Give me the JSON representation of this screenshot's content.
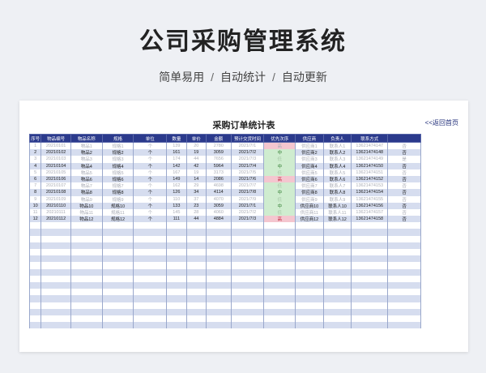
{
  "hero": {
    "title": "公司采购管理系统",
    "subtitle_parts": [
      "简单易用",
      "自动统计",
      "自动更新"
    ],
    "separator": "/"
  },
  "sheet": {
    "title": "采购订单统计表",
    "back_link": "<<返回首页"
  },
  "table": {
    "columns": [
      "序号",
      "物品编号",
      "物品名称",
      "规格",
      "单位",
      "数量",
      "单价",
      "金额",
      "预计交货时间",
      "优先次序",
      "供应商",
      "负责人",
      "联系方式",
      ""
    ],
    "rows": [
      {
        "no": "1",
        "code": "20210101",
        "name": "物品1",
        "spec": "规格1",
        "unit": "个",
        "qty": "139",
        "price": "20",
        "amount": "2780",
        "date": "2021/7/1",
        "priority": "高",
        "supplier": "供应商1",
        "owner": "联系人1",
        "phone": "13621474147",
        "extra": "否",
        "faded": true
      },
      {
        "no": "2",
        "code": "20210102",
        "name": "物品2",
        "spec": "规格2",
        "unit": "个",
        "qty": "161",
        "price": "19",
        "amount": "3059",
        "date": "2021/7/2",
        "priority": "中",
        "supplier": "供应商2",
        "owner": "联系人2",
        "phone": "13621474148",
        "extra": "否",
        "faded": false
      },
      {
        "no": "3",
        "code": "20210103",
        "name": "物品3",
        "spec": "规格3",
        "unit": "个",
        "qty": "174",
        "price": "44",
        "amount": "7656",
        "date": "2021/7/3",
        "priority": "低",
        "supplier": "供应商3",
        "owner": "联系人3",
        "phone": "13621474149",
        "extra": "是",
        "faded": true
      },
      {
        "no": "4",
        "code": "20210104",
        "name": "物品4",
        "spec": "规格4",
        "unit": "个",
        "qty": "142",
        "price": "42",
        "amount": "5964",
        "date": "2021/7/4",
        "priority": "中",
        "supplier": "供应商4",
        "owner": "联系人4",
        "phone": "13621474150",
        "extra": "否",
        "faded": false
      },
      {
        "no": "5",
        "code": "20210105",
        "name": "物品5",
        "spec": "规格5",
        "unit": "个",
        "qty": "167",
        "price": "19",
        "amount": "3173",
        "date": "2021/7/5",
        "priority": "低",
        "supplier": "供应商5",
        "owner": "联系人5",
        "phone": "13621474151",
        "extra": "否",
        "faded": true
      },
      {
        "no": "6",
        "code": "20210106",
        "name": "物品6",
        "spec": "规格6",
        "unit": "个",
        "qty": "149",
        "price": "14",
        "amount": "2086",
        "date": "2021/7/6",
        "priority": "高",
        "supplier": "供应商6",
        "owner": "联系人6",
        "phone": "13621474152",
        "extra": "否",
        "faded": false
      },
      {
        "no": "7",
        "code": "20210107",
        "name": "物品7",
        "spec": "规格7",
        "unit": "个",
        "qty": "162",
        "price": "29",
        "amount": "4698",
        "date": "2021/7/7",
        "priority": "低",
        "supplier": "供应商7",
        "owner": "联系人7",
        "phone": "13621474153",
        "extra": "否",
        "faded": true
      },
      {
        "no": "8",
        "code": "20210108",
        "name": "物品8",
        "spec": "规格8",
        "unit": "个",
        "qty": "126",
        "price": "34",
        "amount": "4114",
        "date": "2021/7/8",
        "priority": "中",
        "supplier": "供应商8",
        "owner": "联系人8",
        "phone": "13621474154",
        "extra": "否",
        "faded": false
      },
      {
        "no": "9",
        "code": "20210109",
        "name": "物品9",
        "spec": "规格9",
        "unit": "个",
        "qty": "110",
        "price": "37",
        "amount": "4070",
        "date": "2021/7/9",
        "priority": "低",
        "supplier": "供应商9",
        "owner": "联系人9",
        "phone": "13621474155",
        "extra": "否",
        "faded": true
      },
      {
        "no": "10",
        "code": "20210110",
        "name": "物品10",
        "spec": "规格10",
        "unit": "个",
        "qty": "133",
        "price": "23",
        "amount": "3059",
        "date": "2021/7/1",
        "priority": "中",
        "supplier": "供应商10",
        "owner": "联系人10",
        "phone": "13621474156",
        "extra": "否",
        "faded": false
      },
      {
        "no": "11",
        "code": "20210111",
        "name": "物品11",
        "spec": "规格11",
        "unit": "个",
        "qty": "145",
        "price": "28",
        "amount": "4060",
        "date": "2021/7/2",
        "priority": "低",
        "supplier": "供应商11",
        "owner": "联系人11",
        "phone": "13621474157",
        "extra": "否",
        "faded": true
      },
      {
        "no": "12",
        "code": "20210112",
        "name": "物品12",
        "spec": "规格12",
        "unit": "个",
        "qty": "111",
        "price": "44",
        "amount": "4884",
        "date": "2021/7/3",
        "priority": "高",
        "supplier": "供应商12",
        "owner": "联系人12",
        "phone": "13621474158",
        "extra": "否",
        "faded": false
      }
    ],
    "empty_rows": 16
  },
  "colors": {
    "header_bg": "#2b3a8c",
    "stripe": "#d6ddef",
    "priority_high": "#f4c6cf",
    "priority_mid_low": "#cfeccf"
  }
}
